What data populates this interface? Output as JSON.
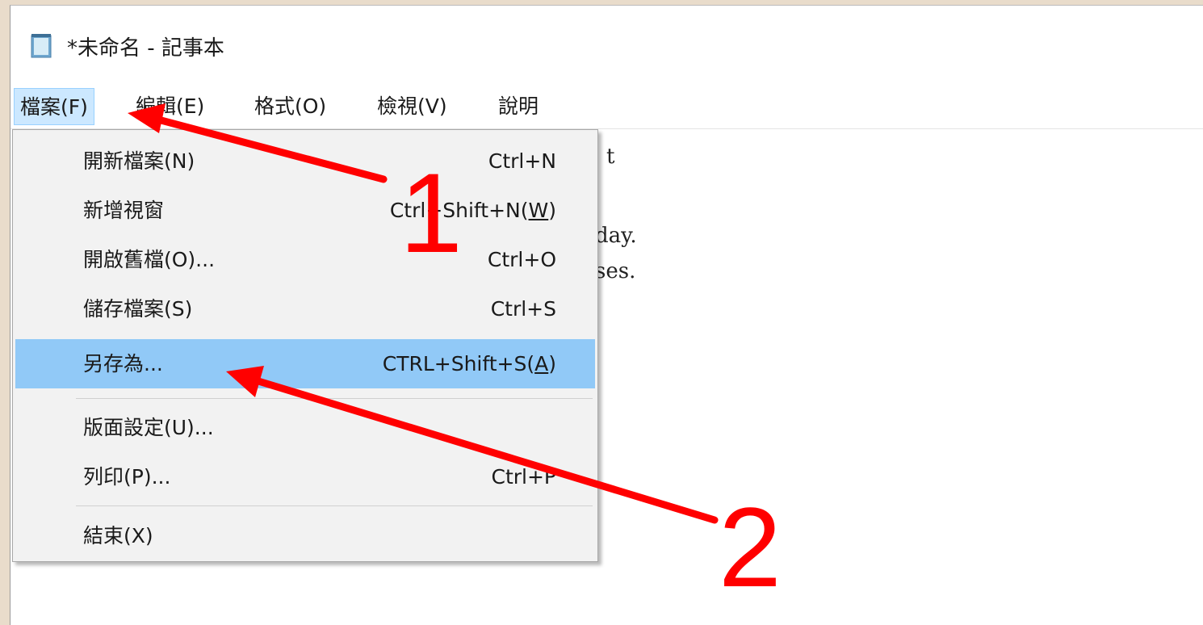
{
  "window": {
    "title": "*未命名 - 記事本"
  },
  "menubar": {
    "items": [
      {
        "label": "檔案(F)"
      },
      {
        "label": "編輯(E)"
      },
      {
        "label": "格式(O)"
      },
      {
        "label": "檢視(V)"
      },
      {
        "label": "說明"
      }
    ]
  },
  "document": {
    "lines": [
      "t",
      "day.",
      "ses."
    ]
  },
  "file_menu": {
    "items": [
      {
        "label": "開新檔案(N)",
        "shortcut": "Ctrl+N"
      },
      {
        "label": "新增視窗",
        "shortcut_prefix": "Ctrl+Shift+N(",
        "shortcut_key": "W",
        "shortcut_suffix": ")"
      },
      {
        "label": "開啟舊檔(O)...",
        "shortcut": "Ctrl+O"
      },
      {
        "label": "儲存檔案(S)",
        "shortcut": "Ctrl+S"
      },
      {
        "label": "另存為...",
        "shortcut_prefix": "CTRL+Shift+S(",
        "shortcut_key": "A",
        "shortcut_suffix": ")"
      },
      {
        "label": "版面設定(U)..."
      },
      {
        "label": "列印(P)...",
        "shortcut": "Ctrl+P"
      },
      {
        "label": "結束(X)"
      }
    ]
  },
  "annotations": {
    "step1": "1",
    "step2": "2",
    "color": "#ff0000"
  },
  "colors": {
    "highlight": "#91c9f7",
    "menu_active": "#cce8ff",
    "background": "#e9dccb"
  }
}
